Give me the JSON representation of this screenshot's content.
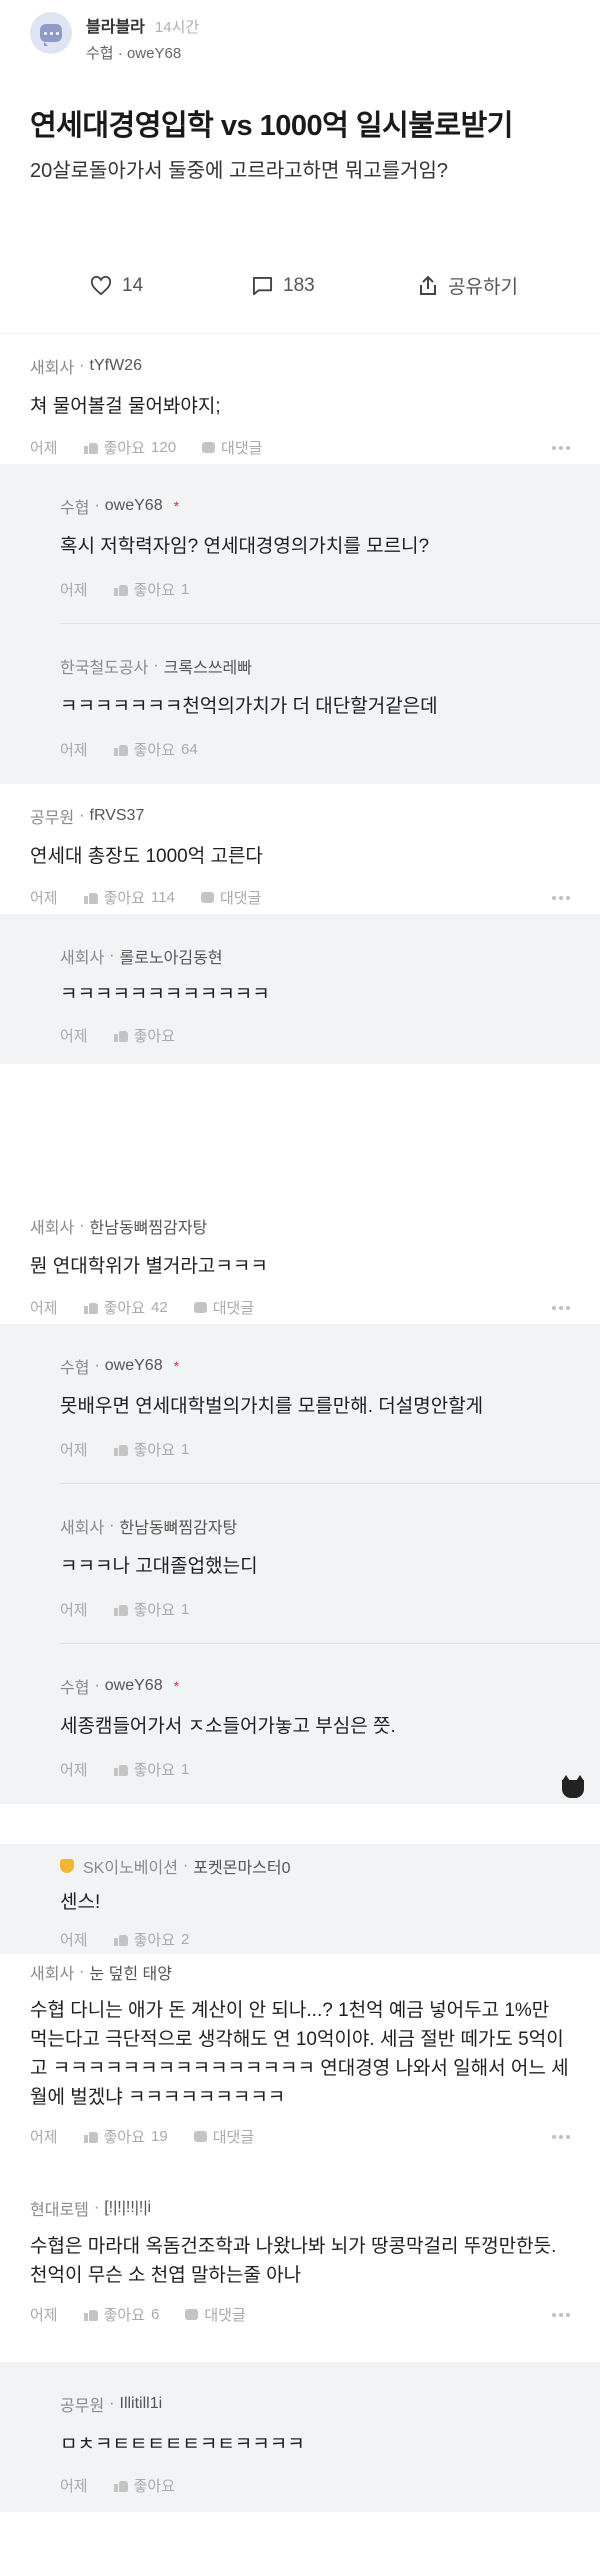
{
  "header": {
    "channel_name": "블라블라",
    "time": "14시간",
    "org": "수협",
    "nick": "oweY68"
  },
  "post": {
    "title": "연세대경영입학 vs 1000억 일시불로받기",
    "body": "20살로돌아가서 둘중에 고르라고하면 뭐고를거임?"
  },
  "actions": {
    "like_count": "14",
    "comment_count": "183",
    "share_label": "공유하기"
  },
  "labels": {
    "ago": "어제",
    "like": "좋아요",
    "reply": "대댓글"
  },
  "comments": [
    {
      "org": "새회사",
      "nick": "tYfW26",
      "text": "쳐 물어볼걸 물어봐야지;",
      "likes": "120"
    },
    {
      "org": "수협",
      "nick": "oweY68",
      "text": "혹시 저학력자임? 연세대경영의가치를 모르니?",
      "likes": "1"
    },
    {
      "org": "한국철도공사",
      "nick": "크록스쓰레빠",
      "text": "ㅋㅋㅋㅋㅋㅋㅋ천억의가치가 더 대단할거같은데",
      "likes": "64"
    },
    {
      "org": "공무원",
      "nick": "fRVS37",
      "text": "연세대 총장도 1000억 고른다",
      "likes": "114"
    },
    {
      "org": "새회사",
      "nick": "롤로노아김동현",
      "text": "ㅋㅋㅋㅋㅋㅋㅋㅋㅋㅋㅋㅋ",
      "likes": ""
    },
    {
      "org": "새회사",
      "nick": "한남동뼈찜감자탕",
      "text": "뭔 연대학위가 별거라고ㅋㅋㅋ",
      "likes": "42"
    },
    {
      "org": "수협",
      "nick": "oweY68",
      "text": "못배우면 연세대학벌의가치를 모를만해. 더설명안할게",
      "likes": "1"
    },
    {
      "org": "새회사",
      "nick": "한남동뼈찜감자탕",
      "text": "ㅋㅋㅋ나 고대졸업했는디",
      "likes": "1"
    },
    {
      "org": "수협",
      "nick": "oweY68",
      "text": "세종캠들어가서 ㅈ소들어가놓고 부심은 쯧.",
      "likes": "1"
    },
    {
      "org": "SK이노베이션",
      "nick": "포켓몬마스터0",
      "text": "센스!",
      "likes": "2"
    },
    {
      "org": "새회사",
      "nick": "눈 덮힌 태양",
      "text": "수협 다니는 애가 돈 계산이 안 되나...? 1천억 예금 넣어두고 1%만 먹는다고 극단적으로 생각해도 연 10억이야. 세금 절반 떼가도 5억이고 ㅋㅋㅋㅋㅋㅋㅋㅋㅋㅋㅋㅋㅋㅋㅋ 연대경영 나와서 일해서 어느 세월에 벌겠냐 ㅋㅋㅋㅋㅋㅋㅋㅋㅋ",
      "likes": "19"
    },
    {
      "org": "현대로템",
      "nick": "[!|!|!!|!|i",
      "text": "수협은 마라대 옥돔건조학과 나왔나봐 뇌가 땅콩막걸리 뚜껑만한듯. 천억이 무슨 소 천엽 말하는줄 아나",
      "likes": "6"
    },
    {
      "org": "공무원",
      "nick": "Illitill1i",
      "text": "ㅁㅊㅋㅌㅌㅌㅌㅌㅋㅌㅋㅋㅋㅋ",
      "likes": ""
    }
  ]
}
